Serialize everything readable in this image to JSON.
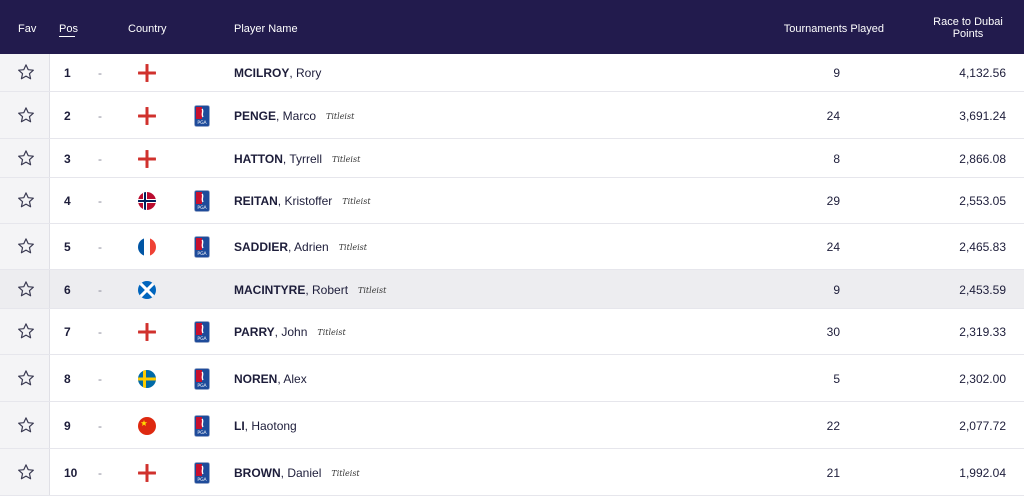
{
  "header": {
    "fav": "Fav",
    "pos": "Pos",
    "country": "Country",
    "player": "Player Name",
    "tournaments": "Tournaments Played",
    "points_line1": "Race to Dubai",
    "points_line2": "Points"
  },
  "colors": {
    "header_bg": "#221b4d",
    "row_alt": "#f4f4f6",
    "pga_blue": "#1e4b9a",
    "pga_red": "#c8102e"
  },
  "rows": [
    {
      "pos": "1",
      "move": "-",
      "flag": "northern-ireland",
      "tour": false,
      "last": "MCILROY",
      "first": "Rory",
      "sponsor": "",
      "played": "9",
      "points": "4,132.56"
    },
    {
      "pos": "2",
      "move": "-",
      "flag": "england",
      "tour": true,
      "last": "PENGE",
      "first": "Marco",
      "sponsor": "Titleist",
      "played": "24",
      "points": "3,691.24"
    },
    {
      "pos": "3",
      "move": "-",
      "flag": "england",
      "tour": false,
      "last": "HATTON",
      "first": "Tyrrell",
      "sponsor": "Titleist",
      "played": "8",
      "points": "2,866.08"
    },
    {
      "pos": "4",
      "move": "-",
      "flag": "norway",
      "tour": true,
      "last": "REITAN",
      "first": "Kristoffer",
      "sponsor": "Titleist",
      "played": "29",
      "points": "2,553.05"
    },
    {
      "pos": "5",
      "move": "-",
      "flag": "france",
      "tour": true,
      "last": "SADDIER",
      "first": "Adrien",
      "sponsor": "Titleist",
      "played": "24",
      "points": "2,465.83"
    },
    {
      "pos": "6",
      "move": "-",
      "flag": "scotland",
      "tour": false,
      "last": "MACINTYRE",
      "first": "Robert",
      "sponsor": "Titleist",
      "played": "9",
      "points": "2,453.59"
    },
    {
      "pos": "7",
      "move": "-",
      "flag": "england",
      "tour": true,
      "last": "PARRY",
      "first": "John",
      "sponsor": "Titleist",
      "played": "30",
      "points": "2,319.33"
    },
    {
      "pos": "8",
      "move": "-",
      "flag": "sweden",
      "tour": true,
      "last": "NOREN",
      "first": "Alex",
      "sponsor": "",
      "played": "5",
      "points": "2,302.00"
    },
    {
      "pos": "9",
      "move": "-",
      "flag": "china",
      "tour": true,
      "last": "LI",
      "first": "Haotong",
      "sponsor": "",
      "played": "22",
      "points": "2,077.72"
    },
    {
      "pos": "10",
      "move": "-",
      "flag": "england",
      "tour": true,
      "last": "BROWN",
      "first": "Daniel",
      "sponsor": "Titleist",
      "played": "21",
      "points": "1,992.04"
    }
  ]
}
